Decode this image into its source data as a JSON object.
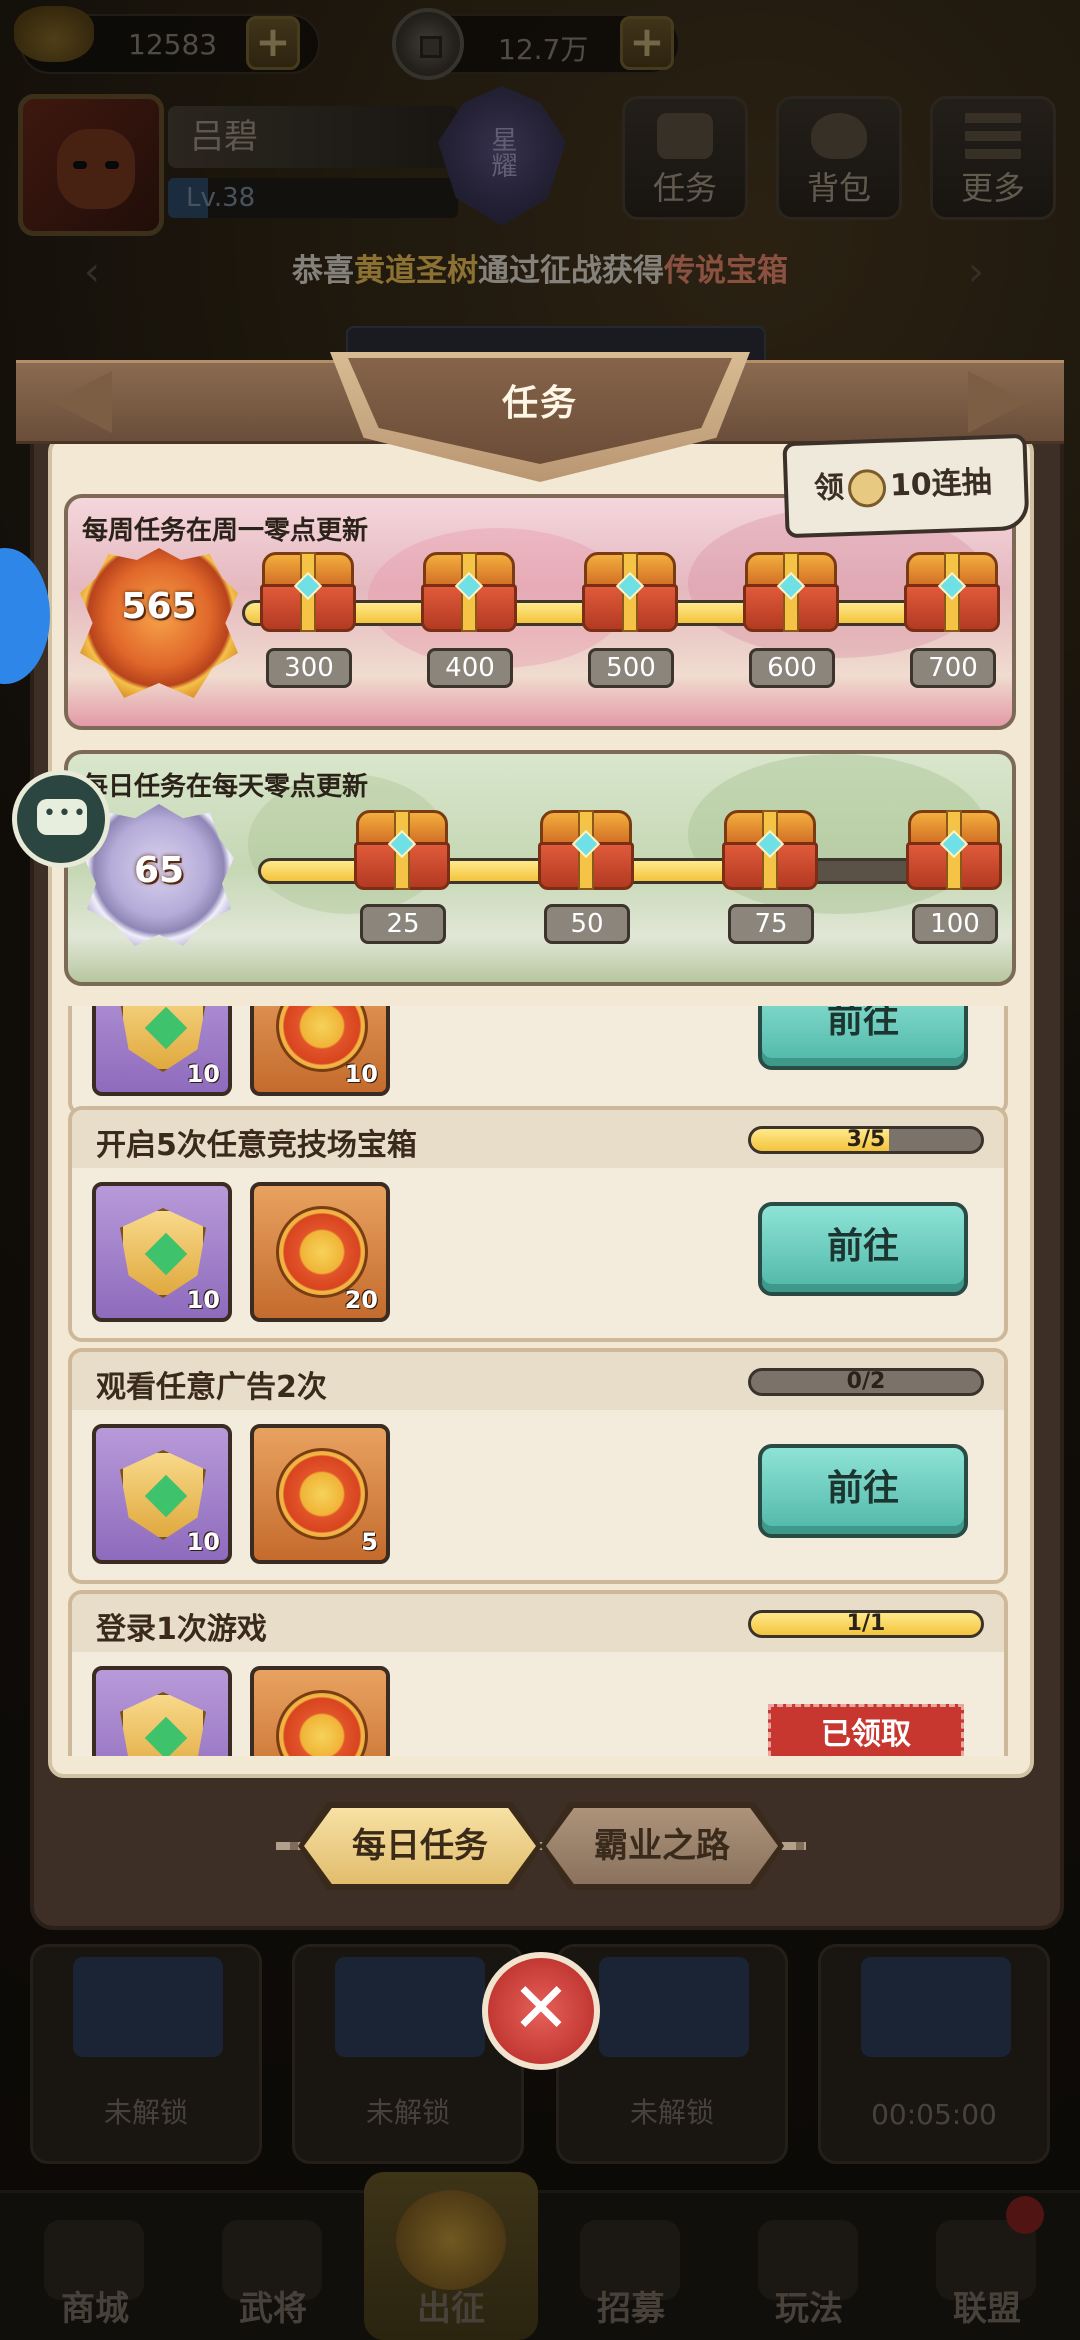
{
  "top_bar": {
    "gold_value": "12583",
    "coin_value": "12.7万"
  },
  "player": {
    "name": "吕碧",
    "level": "Lv.38",
    "rank_text": "星耀"
  },
  "top_menu": [
    {
      "label": "任务",
      "icon": "scroll-icon"
    },
    {
      "label": "背包",
      "icon": "bag-icon"
    },
    {
      "label": "更多",
      "icon": "menu-icon"
    }
  ],
  "announcement": {
    "prefix": "恭喜",
    "player": "黄道圣树",
    "middle": "通过征战获得",
    "item": "传说宝箱"
  },
  "panel": {
    "title": "任务",
    "draw_badge": {
      "prefix": "领",
      "suffix": "10连抽"
    }
  },
  "weekly": {
    "caption": "每周任务在周一零点更新",
    "points": "565",
    "progress_fraction": 1.0,
    "milestones": [
      "300",
      "400",
      "500",
      "600",
      "700"
    ]
  },
  "daily": {
    "caption": "每日任务在每天零点更新",
    "points": "65",
    "progress_fraction": 0.65,
    "milestones": [
      "25",
      "50",
      "75",
      "100"
    ]
  },
  "tasks": [
    {
      "title": "",
      "progress_text": "",
      "progress_fraction": 0,
      "rewards": [
        {
          "icon": "shield-gem-icon",
          "count": "10"
        },
        {
          "icon": "star-medal-icon",
          "count": "10"
        }
      ],
      "button": "前往"
    },
    {
      "title": "开启5次任意竞技场宝箱",
      "progress_text": "3/5",
      "progress_fraction": 0.6,
      "rewards": [
        {
          "icon": "shield-gem-icon",
          "count": "10"
        },
        {
          "icon": "star-medal-icon",
          "count": "20"
        }
      ],
      "button": "前往"
    },
    {
      "title": "观看任意广告2次",
      "progress_text": "0/2",
      "progress_fraction": 0.0,
      "rewards": [
        {
          "icon": "shield-gem-icon",
          "count": "10"
        },
        {
          "icon": "star-medal-icon",
          "count": "5"
        }
      ],
      "button": "前往"
    },
    {
      "title": "登录1次游戏",
      "progress_text": "1/1",
      "progress_fraction": 1.0,
      "rewards": [
        {
          "icon": "shield-gem-icon",
          "count": ""
        },
        {
          "icon": "star-medal-icon",
          "count": ""
        }
      ],
      "button": "已领取"
    }
  ],
  "tabs": {
    "daily": "每日任务",
    "path": "霸业之路"
  },
  "slots": [
    "未解锁",
    "未解锁",
    "未解锁",
    "00:05:00"
  ],
  "bottom_nav": [
    "商城",
    "武将",
    "出征",
    "招募",
    "玩法",
    "联盟"
  ],
  "colors": {
    "progress_fill": "#f3c43c",
    "go_button": "#4fb7a7",
    "claimed_stamp": "#c7372f",
    "close_button": "#c33832"
  }
}
